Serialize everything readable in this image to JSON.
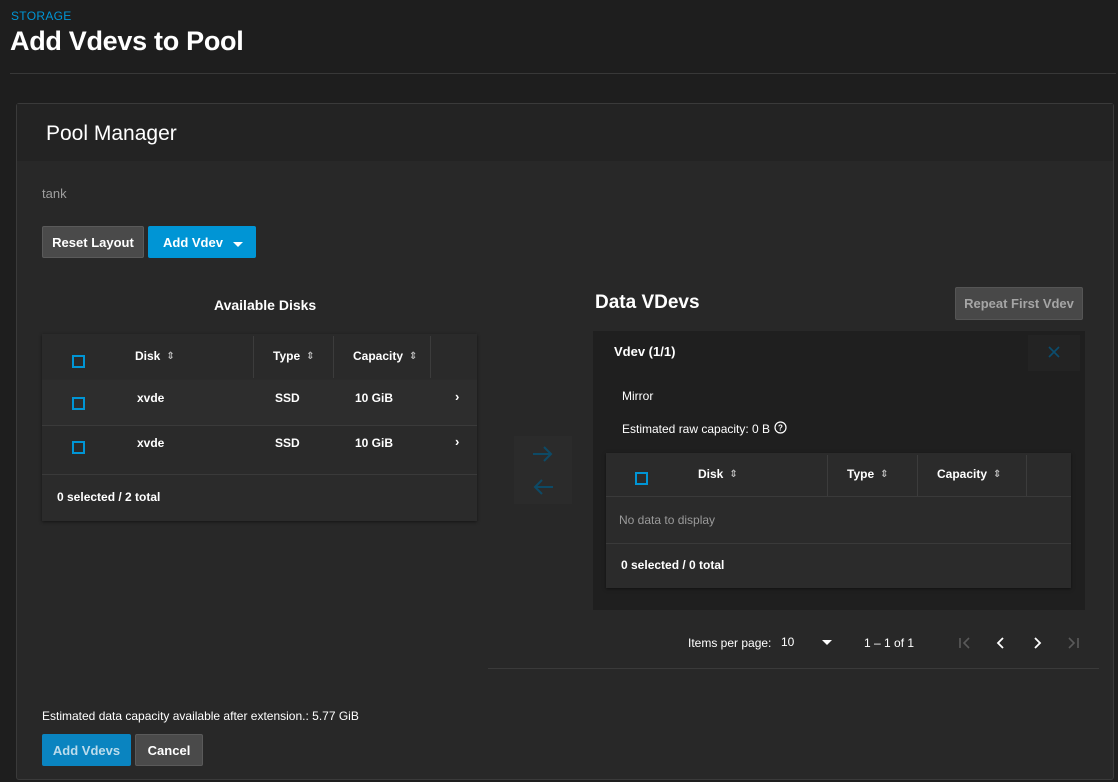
{
  "breadcrumb": "STORAGE",
  "page_title": "Add Vdevs to Pool",
  "card_title": "Pool Manager",
  "pool_name": "tank",
  "toolbar": {
    "reset_label": "Reset Layout",
    "add_vdev_label": "Add Vdev"
  },
  "available": {
    "title": "Available Disks",
    "columns": [
      "Disk",
      "Type",
      "Capacity"
    ],
    "rows": [
      {
        "disk": "xvde",
        "type": "SSD",
        "capacity": "10 GiB"
      },
      {
        "disk": "xvde",
        "type": "SSD",
        "capacity": "10 GiB"
      }
    ],
    "footer": "0 selected / 2 total"
  },
  "data_vdevs": {
    "title": "Data VDevs",
    "repeat_label": "Repeat First Vdev",
    "vdev_title": "Vdev (1/1)",
    "layout": "Mirror",
    "raw_capacity": "Estimated raw capacity: 0 B",
    "columns": [
      "Disk",
      "Type",
      "Capacity"
    ],
    "empty": "No data to display",
    "footer": "0 selected / 0 total"
  },
  "paginator": {
    "items_label": "Items per page:",
    "page_size": "10",
    "range": "1 – 1 of 1"
  },
  "estimate": "Estimated data capacity available after extension.: 5.77 GiB",
  "actions": {
    "submit_label": "Add Vdevs",
    "cancel_label": "Cancel"
  },
  "colors": {
    "accent": "#0095d5",
    "background": "#1e1e1e",
    "card": "#282828"
  }
}
